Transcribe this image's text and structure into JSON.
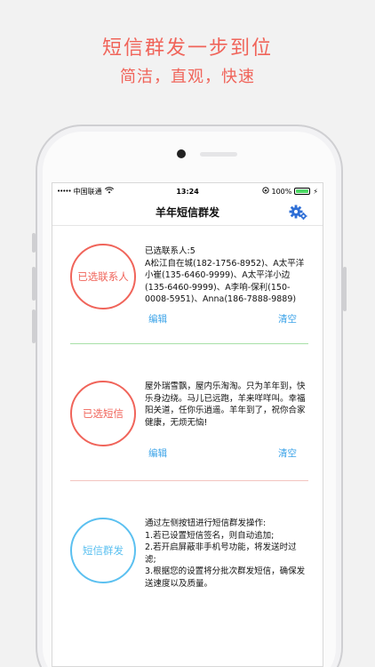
{
  "promo": {
    "headline": "短信群发一步到位",
    "subhead": "简洁，直观，快速"
  },
  "statusbar": {
    "signal": "•••••",
    "carrier": "中国联通",
    "time": "13:24",
    "battery": "100%"
  },
  "navbar": {
    "title": "羊年短信群发",
    "settings_icon": "gear-icon"
  },
  "contacts": {
    "circle_label": "已选联系人",
    "text": "已选联系人:5\nA松江自在城(182-1756-8952)、A太平洋小崔(135-6460-9999)、A太平洋小边(135-6460-9999)、A李响-保利(150-0008-5951)、Anna(186-7888-9889)",
    "edit_label": "编辑",
    "clear_label": "清空",
    "color": "#f0645a"
  },
  "message": {
    "circle_label": "已选短信",
    "text": "屋外瑞雪飘，屋内乐淘淘。只为羊年到，快乐身边绕。马儿已远跑，羊来咩咩叫。幸福阳关道，任你乐逍遥。羊年到了，祝你合家健康，无烦无恼!",
    "edit_label": "编辑",
    "clear_label": "清空",
    "color": "#f0645a"
  },
  "send": {
    "circle_label": "短信群发",
    "text": "通过左侧按钮进行短信群发操作:\n1.若已设置短信签名，则自动追加;\n2.若开启屏蔽非手机号功能，将发送时过滤;\n3.根据您的设置将分批次群发短信，确保发送速度以及质量。",
    "color": "#5bc0f0"
  },
  "colors": {
    "accent_red": "#f0645a",
    "accent_blue": "#5bc0f0",
    "link_blue": "#3ba3e8"
  }
}
